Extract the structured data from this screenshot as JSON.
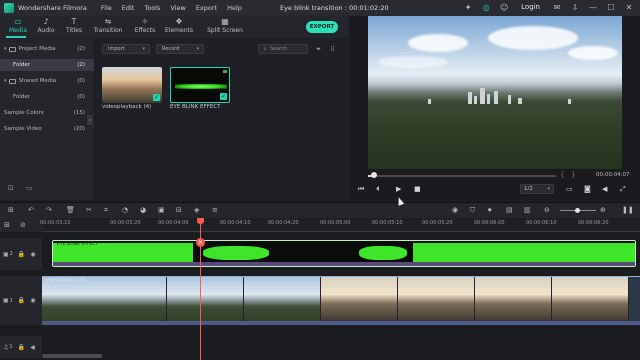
{
  "titlebar": {
    "app_name": "Wondershare Filmora",
    "menu": [
      "File",
      "Edit",
      "Tools",
      "View",
      "Export",
      "Help"
    ],
    "doc_title": "Eye blink transition : 00:01:02:20",
    "login": "Login"
  },
  "toolbar": {
    "tabs": [
      {
        "label": "Media",
        "icon": "folder-icon",
        "active": true
      },
      {
        "label": "Audio",
        "icon": "music-note-icon"
      },
      {
        "label": "Titles",
        "icon": "text-t-icon"
      },
      {
        "label": "Transition",
        "icon": "transition-icon"
      },
      {
        "label": "Effects",
        "icon": "effects-icon"
      },
      {
        "label": "Elements",
        "icon": "elements-icon"
      },
      {
        "label": "Split Screen",
        "icon": "split-screen-icon"
      }
    ],
    "export_label": "EXPORT",
    "accent_color": "#21d4b3"
  },
  "library": {
    "items": [
      {
        "label": "Project Media",
        "count": "(2)",
        "indent": false,
        "chevron": true
      },
      {
        "label": "Folder",
        "count": "(2)",
        "indent": true,
        "selected": true
      },
      {
        "label": "Shared Media",
        "count": "(0)",
        "indent": false,
        "chevron": true
      },
      {
        "label": "Folder",
        "count": "(0)",
        "indent": true
      },
      {
        "label": "Sample Colors",
        "count": "(15)",
        "indent": false
      },
      {
        "label": "Sample Video",
        "count": "(20)",
        "indent": false
      }
    ]
  },
  "media": {
    "import_label": "Import",
    "record_label": "Record",
    "search_placeholder": "Search",
    "items": [
      {
        "label": "videoplayback (4)"
      },
      {
        "label": "EYE BLINK EFFECT"
      }
    ]
  },
  "preview": {
    "timecode": "00:00:04:07",
    "ratio": "1/2",
    "progress": 0.02
  },
  "timeline": {
    "ruler_labels": [
      "00:00:03:10",
      "00:00:03:20",
      "00:00:04:00",
      "00:00:04:10",
      "00:00:04:20",
      "00:00:05:00",
      "00:00:05:10",
      "00:00:05:20",
      "00:00:06:00",
      "00:00:06:10",
      "00:00:06:20"
    ],
    "track2_label": "2",
    "track1_label": "1",
    "audio_track_label": "1",
    "fx_clip_label": "EYE BLINK EFFECT",
    "video_clip_label": "videoplayback (4)",
    "fx_color": "#3fe52a",
    "playhead_color": "#ff5a4a"
  }
}
